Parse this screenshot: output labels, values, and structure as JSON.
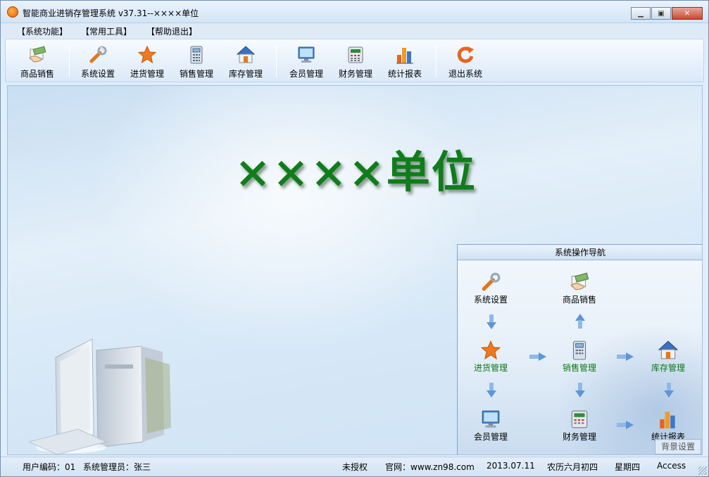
{
  "window": {
    "title": "智能商业进销存管理系统 v37.31--××××单位"
  },
  "menu": {
    "items": [
      "【系统功能】",
      "【常用工具】",
      "【帮助退出】"
    ]
  },
  "toolbar": {
    "items": [
      {
        "label": "商品销售",
        "icon": "hand-card-icon"
      },
      {
        "label": "系统设置",
        "icon": "wrench-icon"
      },
      {
        "label": "进货管理",
        "icon": "star-icon"
      },
      {
        "label": "销售管理",
        "icon": "calculator-icon"
      },
      {
        "label": "库存管理",
        "icon": "house-icon"
      },
      {
        "label": "会员管理",
        "icon": "monitor-icon"
      },
      {
        "label": "财务管理",
        "icon": "cash-register-icon"
      },
      {
        "label": "统计报表",
        "icon": "bar-chart-icon"
      },
      {
        "label": "退出系统",
        "icon": "refresh-icon"
      }
    ]
  },
  "main": {
    "heading": "××××单位"
  },
  "nav": {
    "title": "系统操作导航",
    "nodes": {
      "settings": "系统设置",
      "sales_goods": "商品销售",
      "purchase": "进货管理",
      "sales_mgmt": "销售管理",
      "inventory": "库存管理",
      "member": "会员管理",
      "finance": "财务管理",
      "report": "统计报表"
    },
    "background_button": "背景设置"
  },
  "status": {
    "user_code": "用户编码：01",
    "operator": "系统管理员：张三",
    "license": "未授权",
    "website": "官网：www.zn98.com",
    "date": "2013.07.11",
    "lunar": "农历六月初四",
    "weekday": "星期四",
    "db": "Access"
  },
  "colors": {
    "heading": "#0f7d1a",
    "nav_label_green": "#0a7a14",
    "accent_orange": "#e86a1a"
  }
}
